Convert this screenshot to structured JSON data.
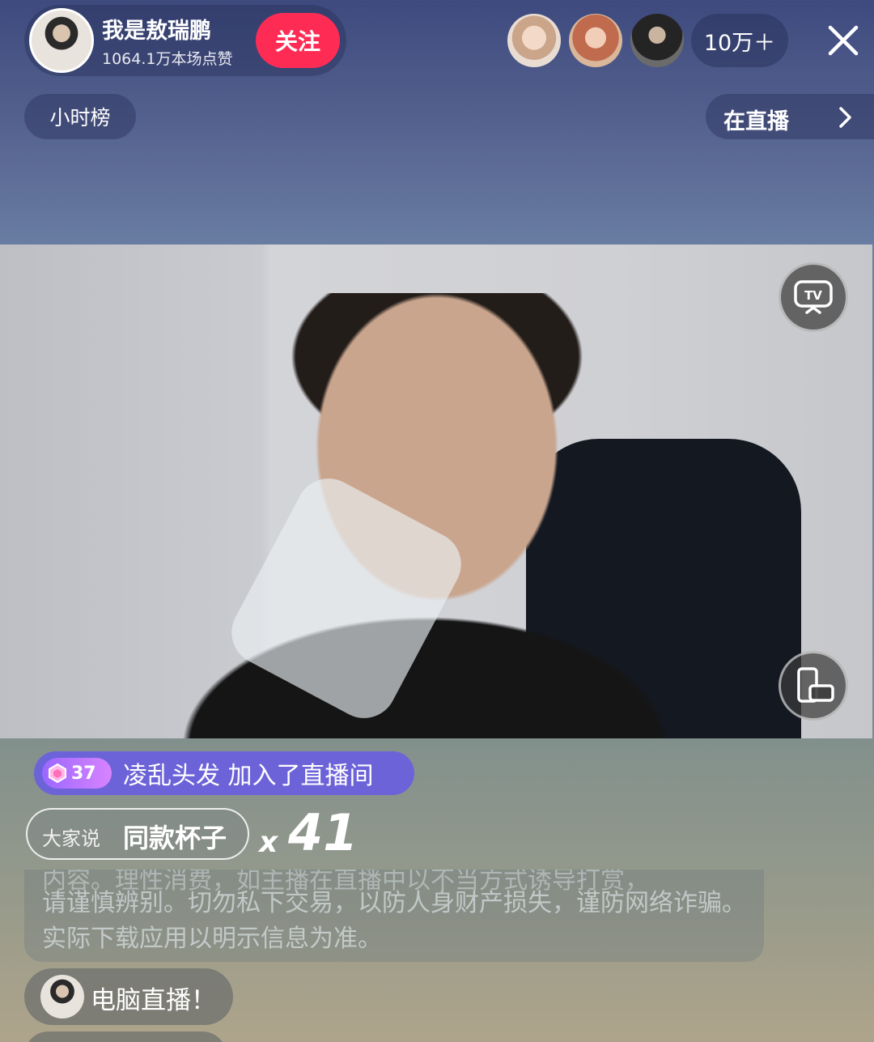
{
  "header": {
    "host_name": "我是敖瑞鹏",
    "likes": "1064.1万本场点赞",
    "follow_label": "关注",
    "viewer_count": "10万＋"
  },
  "nav": {
    "hour_rank": "小时榜",
    "live_now": "在直播"
  },
  "video": {
    "tv_label": "TV"
  },
  "chat": {
    "join_level": "37",
    "join_text": "凌乱头发 加入了直播间",
    "say_label": "大家说",
    "say_value": "同款杯子",
    "say_x": "x",
    "say_count": "41",
    "notice_line0": "内容。理性消费，如主播在直播中以不当方式诱导打赏，",
    "notice_text": "请谨慎辨别。切勿私下交易，以防人身财产损失，谨防网络诈骗。实际下载应用以明示信息为准。",
    "message": "电脑直播！"
  },
  "colors": {
    "follow": "#fe2c55",
    "join_pill": "#6d63d8",
    "level_badge": "#b074ff"
  },
  "icons": [
    "close-icon",
    "chevron-right-icon",
    "tv-icon",
    "rotate-screen-icon",
    "gem-icon"
  ]
}
